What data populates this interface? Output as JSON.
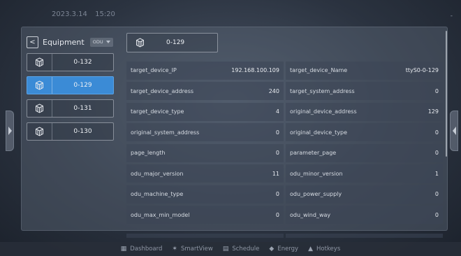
{
  "status_bar": {
    "date": "2023.3.14",
    "time": "15:20",
    "dot": "-"
  },
  "equipment": {
    "back_label": "<",
    "title": "Equipment",
    "type_selected": "ODU",
    "devices": [
      {
        "name": "0-132",
        "active": false
      },
      {
        "name": "0-129",
        "active": true
      },
      {
        "name": "0-131",
        "active": false
      },
      {
        "name": "0-130",
        "active": false
      }
    ]
  },
  "selected_device": {
    "name": "0-129"
  },
  "params": [
    {
      "l_label": "target_device_IP",
      "l_value": "192.168.100.109",
      "r_label": "target_device_Name",
      "r_value": "ttyS0-0-129"
    },
    {
      "l_label": "target_device_address",
      "l_value": "240",
      "r_label": "target_system_address",
      "r_value": "0"
    },
    {
      "l_label": "target_device_type",
      "l_value": "4",
      "r_label": "original_device_address",
      "r_value": "129"
    },
    {
      "l_label": "original_system_address",
      "l_value": "0",
      "r_label": "original_device_type",
      "r_value": "0"
    },
    {
      "l_label": "page_length",
      "l_value": "0",
      "r_label": "parameter_page",
      "r_value": "0"
    },
    {
      "l_label": "odu_major_version",
      "l_value": "11",
      "r_label": "odu_minor_version",
      "r_value": "1"
    },
    {
      "l_label": "odu_machine_type",
      "l_value": "0",
      "r_label": "odu_power_supply",
      "r_value": "0"
    },
    {
      "l_label": "odu_max_min_model",
      "l_value": "0",
      "r_label": "odu_wind_way",
      "r_value": "0"
    }
  ],
  "nav": {
    "items": [
      {
        "label": "Dashboard",
        "icon": "dashboard-icon"
      },
      {
        "label": "SmartView",
        "icon": "smartview-icon"
      },
      {
        "label": "Schedule",
        "icon": "schedule-icon"
      },
      {
        "label": "Energy",
        "icon": "energy-icon"
      },
      {
        "label": "Hotkeys",
        "icon": "hotkeys-icon"
      }
    ]
  }
}
